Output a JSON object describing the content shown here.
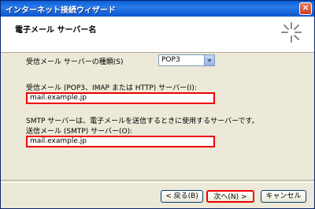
{
  "window": {
    "title": "インターネット接続ウィザード"
  },
  "header": {
    "title": "電子メール サーバー名"
  },
  "incoming_type": {
    "label": "受信メール サーバーの種類(S)",
    "selected": "POP3"
  },
  "incoming_server": {
    "label": "受信メール (POP3、IMAP または HTTP) サーバー(I):",
    "value": "mail.example.jp"
  },
  "smtp_info": "SMTP サーバーは、電子メールを送信するときに使用するサーバーです。",
  "outgoing_server": {
    "label": "送信メール (SMTP) サーバー(O):",
    "value": "mail.example.jp"
  },
  "buttons": {
    "back": "< 戻る(B)",
    "next": "次へ(N) >",
    "cancel": "キャンセル"
  },
  "icons": {
    "close": "close-icon",
    "wizard": "wizard-sparkle-icon",
    "dropdown": "chevron-down-icon"
  },
  "colors": {
    "titlebar": "#0a5fd8",
    "highlight": "#e00000",
    "dialog_bg": "#ece9d8"
  }
}
